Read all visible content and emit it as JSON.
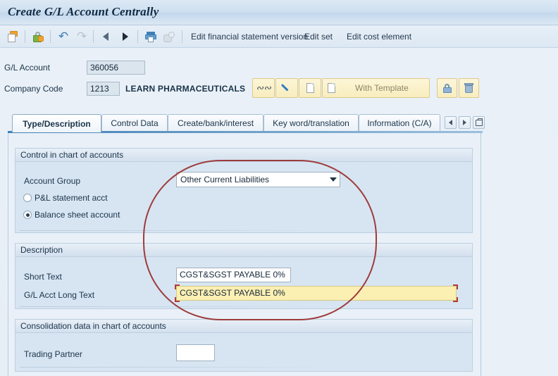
{
  "window": {
    "title": "Create G/L Account Centrally"
  },
  "toolbar": {
    "icons": [
      {
        "name": "save-icon",
        "title": "Save"
      },
      {
        "name": "lock-key-icon",
        "title": "Other G/L Account"
      },
      {
        "name": "undo-icon",
        "title": "Undo"
      },
      {
        "name": "redo-icon",
        "title": "Redo"
      },
      {
        "name": "previous-icon",
        "title": "Previous"
      },
      {
        "name": "next-icon",
        "title": "Next"
      },
      {
        "name": "display-change-icon",
        "title": "Display/Change"
      },
      {
        "name": "document-icon",
        "title": "Documents"
      }
    ],
    "links": [
      {
        "label": "Edit financial statement version"
      },
      {
        "label": "Edit set"
      },
      {
        "label": "Edit cost element"
      }
    ]
  },
  "header": {
    "gl_account_label": "G/L Account",
    "gl_account_value": "360056",
    "company_code_label": "Company Code",
    "company_code_value": "1213",
    "company_name": "LEARN PHARMACEUTICALS",
    "buttons": [
      {
        "name": "signature-button",
        "label": ""
      },
      {
        "name": "edit-button",
        "label": ""
      },
      {
        "name": "create-button",
        "label": ""
      },
      {
        "name": "with-template-button",
        "label": "With Template"
      },
      {
        "name": "lock-button",
        "label": ""
      },
      {
        "name": "delete-button",
        "label": ""
      }
    ],
    "with_template_label": "With Template"
  },
  "tabs": {
    "items": [
      {
        "label": "Type/Description",
        "active": true
      },
      {
        "label": "Control Data",
        "active": false
      },
      {
        "label": "Create/bank/interest",
        "active": false
      },
      {
        "label": "Key word/translation",
        "active": false
      },
      {
        "label": "Information (C/A)",
        "active": false
      }
    ],
    "nav_prev": "",
    "nav_next": "",
    "nav_list": ""
  },
  "form": {
    "group_control": {
      "title": "Control in chart of accounts",
      "account_group_label": "Account Group",
      "account_group_value": "Other Current Liabilities",
      "pl_radio_label": "P&L statement acct",
      "pl_radio_selected": false,
      "balance_radio_label": "Balance sheet account",
      "balance_radio_selected": true
    },
    "group_description": {
      "title": "Description",
      "short_text_label": "Short Text",
      "short_text_value": "CGST&SGST PAYABLE 0%",
      "long_text_label": "G/L Acct Long Text",
      "long_text_value": "CGST&SGST PAYABLE 0%",
      "long_text_focused": true
    },
    "group_consolidation": {
      "title": "Consolidation data in chart of accounts",
      "trading_partner_label": "Trading Partner",
      "trading_partner_value": ""
    }
  },
  "annotation": {
    "name": "red-highlight-ellipse",
    "color": "#9e3b3b"
  },
  "colors": {
    "titlebar": "#cfe0f0",
    "group_bg": "#d7e5f2",
    "panel_bg": "#e9f0f8",
    "focus_field": "#fbefb2",
    "accent": "#3f7fb5",
    "annotation": "#9e3b3b"
  }
}
